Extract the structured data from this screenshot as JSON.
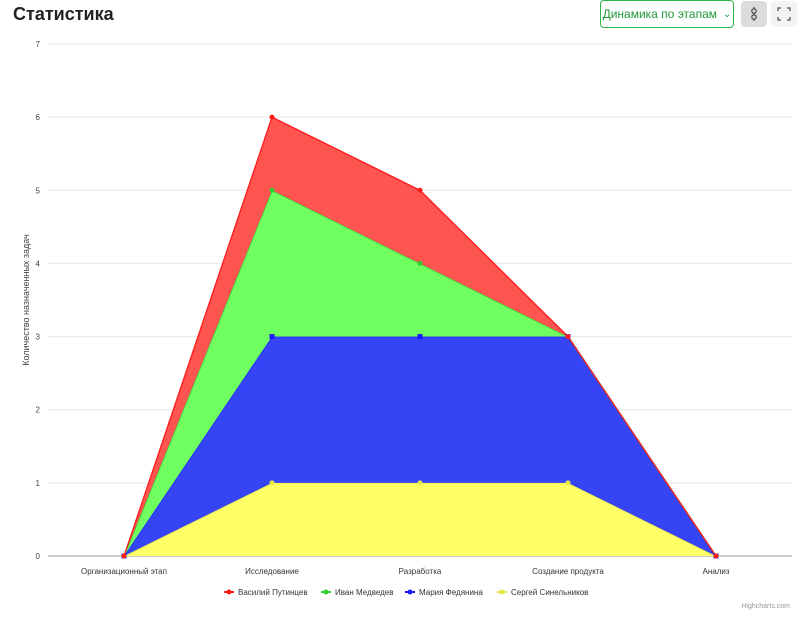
{
  "header": {
    "title": "Статистика",
    "dropdown_label": "Динамика по этапам",
    "filter_icon": "sliders-icon",
    "expand_icon": "fullscreen-icon"
  },
  "chart_data": {
    "type": "area",
    "stacked": true,
    "categories": [
      "Организационный этап",
      "Исследование",
      "Разработка",
      "Создание продукта",
      "Анализ"
    ],
    "ylabel": "Количество назначенных задач",
    "ylim": [
      0,
      7
    ],
    "yticks": [
      0,
      1,
      2,
      3,
      4,
      5,
      6,
      7
    ],
    "grid": true,
    "legend": "bottom-center",
    "credits": "Highcharts.com",
    "series": [
      {
        "name": "Сергей Синельников",
        "color": "#ffff66",
        "line": "#e6e64d",
        "values": [
          0,
          1,
          1,
          1,
          0
        ]
      },
      {
        "name": "Мария Федянина",
        "color": "#3545f5",
        "line": "#1a1aff",
        "values": [
          0,
          2,
          2,
          2,
          0
        ]
      },
      {
        "name": "Иван Медведев",
        "color": "#70ff60",
        "line": "#33cc33",
        "values": [
          0,
          2,
          1,
          0,
          0
        ]
      },
      {
        "name": "Василий Путинцев",
        "color": "#ff5550",
        "line": "#ff1a1a",
        "values": [
          0,
          1,
          1,
          0,
          0
        ]
      }
    ]
  }
}
